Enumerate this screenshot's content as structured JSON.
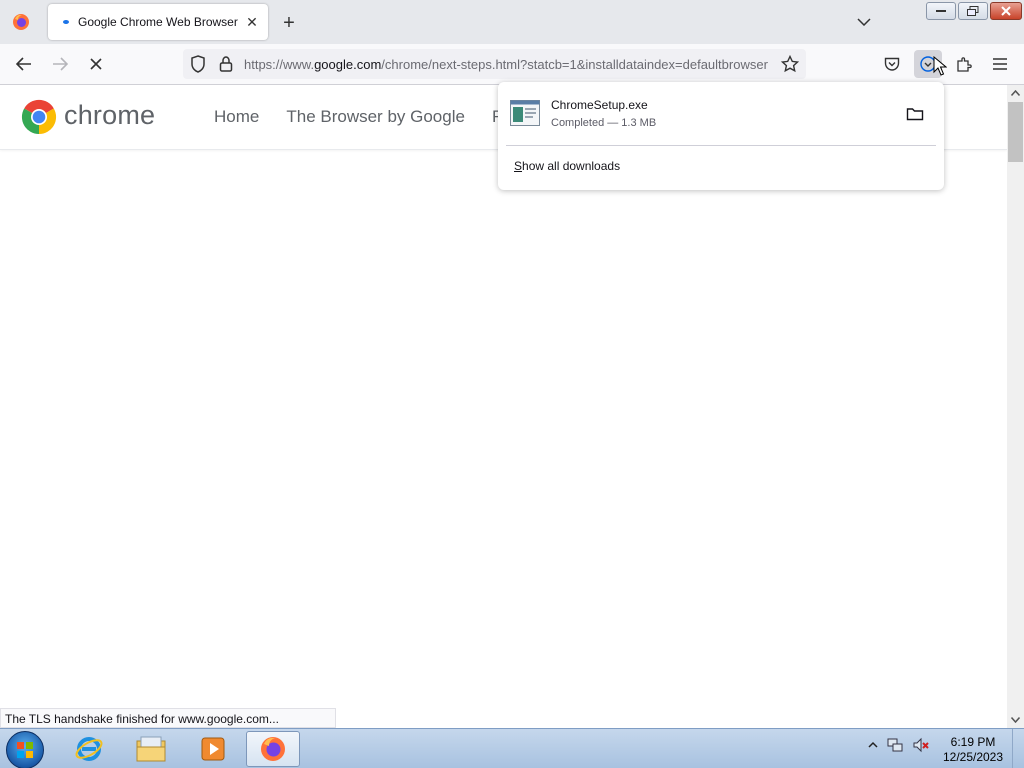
{
  "browser": {
    "tab": {
      "title": "Google Chrome Web Browser"
    },
    "url": {
      "prefix": "https://www.",
      "host": "google.com",
      "path": "/chrome/next-steps.html?statcb=1&installdataindex=defaultbrowser"
    }
  },
  "site": {
    "logo_text": "chrome",
    "nav": [
      "Home",
      "The Browser by Google",
      "Fe"
    ]
  },
  "downloads_panel": {
    "file_name": "ChromeSetup.exe",
    "file_status": "Completed — 1.3 MB",
    "show_all_first": "S",
    "show_all_rest": "how all downloads"
  },
  "status_bar": {
    "text": "The TLS handshake finished for www.google.com..."
  },
  "taskbar": {
    "time": "6:19 PM",
    "date": "12/25/2023"
  },
  "colors": {
    "chrome_red": "#ea4335",
    "chrome_yellow": "#fbbc04",
    "chrome_green": "#34a853",
    "chrome_blue": "#4285f4"
  }
}
